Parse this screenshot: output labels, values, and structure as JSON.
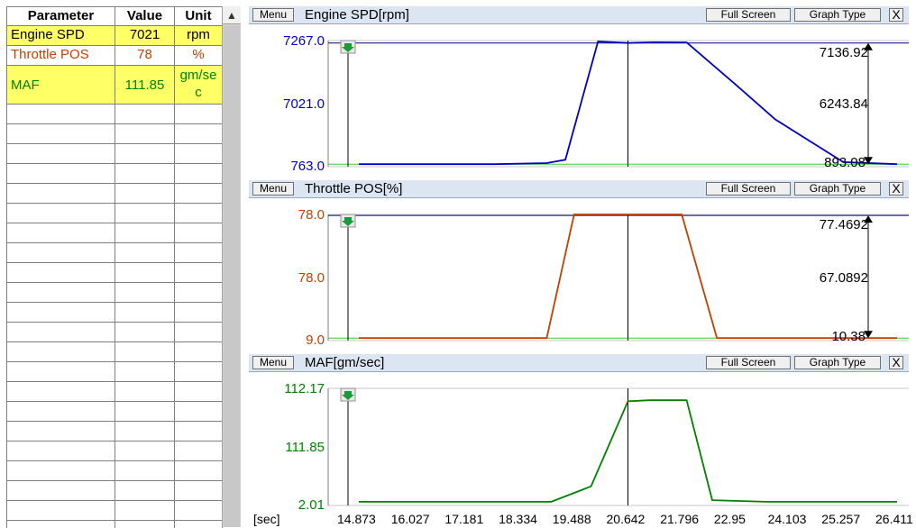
{
  "table": {
    "headers": {
      "parameter": "Parameter",
      "value": "Value",
      "unit": "Unit"
    },
    "rows": [
      {
        "parameter": "Engine SPD",
        "value": "7021",
        "unit": "rpm",
        "highlight": true,
        "color": "#000000"
      },
      {
        "parameter": "Throttle POS",
        "value": "78",
        "unit": "%",
        "highlight": false,
        "color": "#c04000"
      },
      {
        "parameter": "MAF",
        "value": "111.85",
        "unit": "gm/sec",
        "highlight": true,
        "color": "#008000"
      }
    ]
  },
  "buttons": {
    "menu": "Menu",
    "full_screen": "Full Screen",
    "graph_type": "Graph Type",
    "close": "X"
  },
  "panels": [
    {
      "title": "Engine SPD[rpm]",
      "color": "#0000c0",
      "ticks": {
        "top": "7267.0",
        "mid": "7021.0",
        "bottom": "763.0"
      },
      "cursor": {
        "top": "7136.92",
        "delta": "6243.84",
        "bottom": "893.08"
      },
      "ylim": [
        763,
        7267
      ],
      "upper_ref": 7136.92,
      "lower_ref": 893.08,
      "t": [
        14.873,
        16.5,
        17.8,
        18.9,
        19.3,
        20.0,
        20.642,
        21.2,
        21.9,
        22.95,
        23.8,
        25.257,
        26.411
      ],
      "y": [
        893,
        893,
        893,
        950,
        1120,
        7220,
        7140,
        7180,
        7170,
        5000,
        3200,
        1000,
        893
      ]
    },
    {
      "title": "Throttle POS[%]",
      "color": "#c04000",
      "ticks": {
        "top": "78.0",
        "mid": "78.0",
        "bottom": "9.0"
      },
      "cursor": {
        "top": "77.4692",
        "delta": "67.0892",
        "bottom": "10.38"
      },
      "ylim": [
        9,
        78
      ],
      "upper_ref": 77.4692,
      "lower_ref": 10.38,
      "t": [
        14.873,
        17.9,
        18.9,
        19.488,
        20.642,
        21.796,
        22.55,
        23.0,
        26.411
      ],
      "y": [
        10.38,
        10.38,
        10.38,
        78,
        78,
        78,
        10.38,
        10.38,
        10.38
      ]
    },
    {
      "title": "MAF[gm/sec]",
      "color": "#008000",
      "ticks": {
        "top": "112.17",
        "mid": "111.85",
        "bottom": "2.01"
      },
      "ylim": [
        2.01,
        112.17
      ],
      "t": [
        14.873,
        16.5,
        18.2,
        19.0,
        19.85,
        20.642,
        21.1,
        21.9,
        22.45,
        23.6,
        24.4,
        25.3,
        26.411
      ],
      "y": [
        5.5,
        5.5,
        5.5,
        5.5,
        20,
        100,
        101,
        101,
        7,
        5.5,
        5.5,
        5.5,
        5.5
      ]
    }
  ],
  "time_axis": {
    "unit": "[sec]",
    "ticks": [
      "14.873",
      "16.027",
      "17.181",
      "18.334",
      "19.488",
      "20.642",
      "21.796",
      "22.95",
      "24.103",
      "25.257",
      "26.411"
    ]
  }
}
